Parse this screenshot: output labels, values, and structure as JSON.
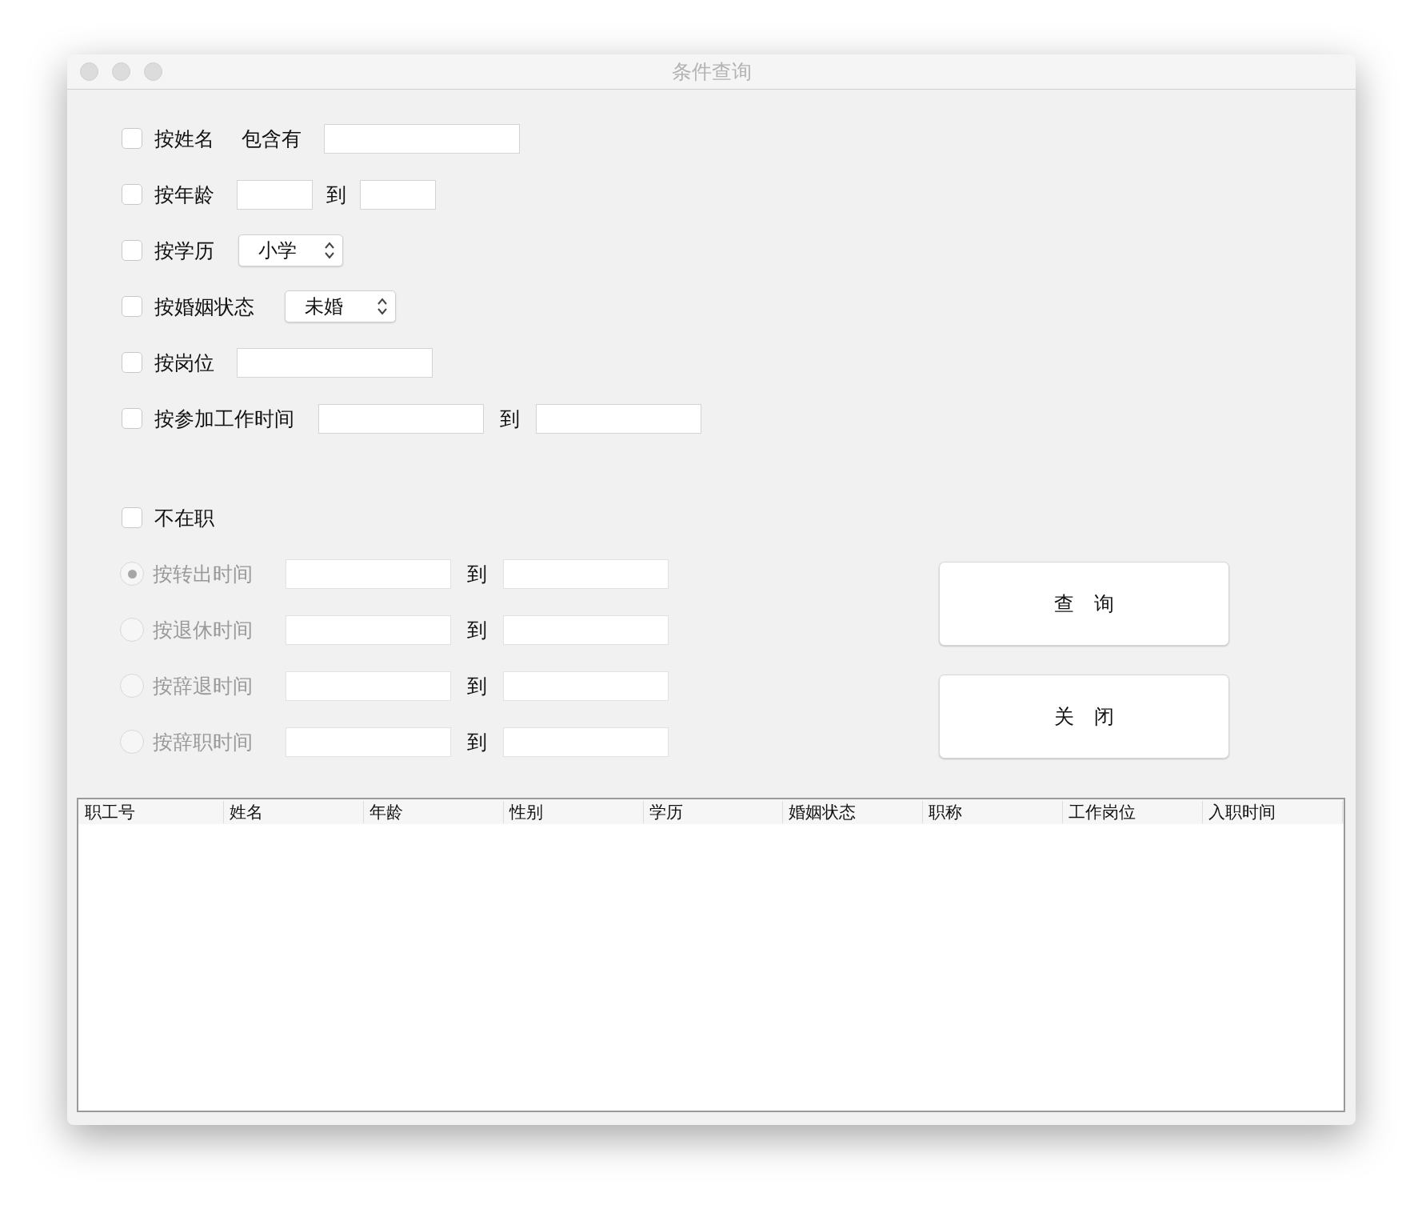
{
  "window": {
    "title": "条件查询"
  },
  "criteria": [
    {
      "label": "按姓名",
      "checked": false,
      "controls": [
        {
          "kind": "text",
          "text": "包含有"
        },
        {
          "kind": "field"
        }
      ]
    },
    {
      "label": "按年龄",
      "checked": false,
      "controls": [
        {
          "kind": "field"
        },
        {
          "kind": "text",
          "text": "到"
        },
        {
          "kind": "field"
        }
      ]
    },
    {
      "label": "按学历",
      "checked": false,
      "controls": [
        {
          "kind": "select",
          "value": "小学"
        }
      ]
    },
    {
      "label": "按婚姻状态",
      "checked": false,
      "controls": [
        {
          "kind": "select",
          "value": "未婚"
        }
      ]
    },
    {
      "label": "按岗位",
      "checked": false,
      "controls": [
        {
          "kind": "field"
        }
      ]
    },
    {
      "label": "按参加工作时间",
      "checked": false,
      "controls": [
        {
          "kind": "field"
        },
        {
          "kind": "text",
          "text": "到"
        },
        {
          "kind": "field"
        }
      ]
    }
  ],
  "not_employed": {
    "label": "不在职",
    "checked": false
  },
  "leave_options": [
    {
      "label": "按转出时间",
      "selected": true,
      "disabled": true,
      "to": "到"
    },
    {
      "label": "按退休时间",
      "selected": false,
      "disabled": true,
      "to": "到"
    },
    {
      "label": "按辞退时间",
      "selected": false,
      "disabled": true,
      "to": "到"
    },
    {
      "label": "按辞职时间",
      "selected": false,
      "disabled": true,
      "to": "到"
    }
  ],
  "buttons": [
    "查　询",
    "关　闭"
  ],
  "table": {
    "columns": [
      "职工号",
      "姓名",
      "年龄",
      "性别",
      "学历",
      "婚姻状态",
      "职称",
      "工作岗位",
      "入职时间"
    ]
  }
}
